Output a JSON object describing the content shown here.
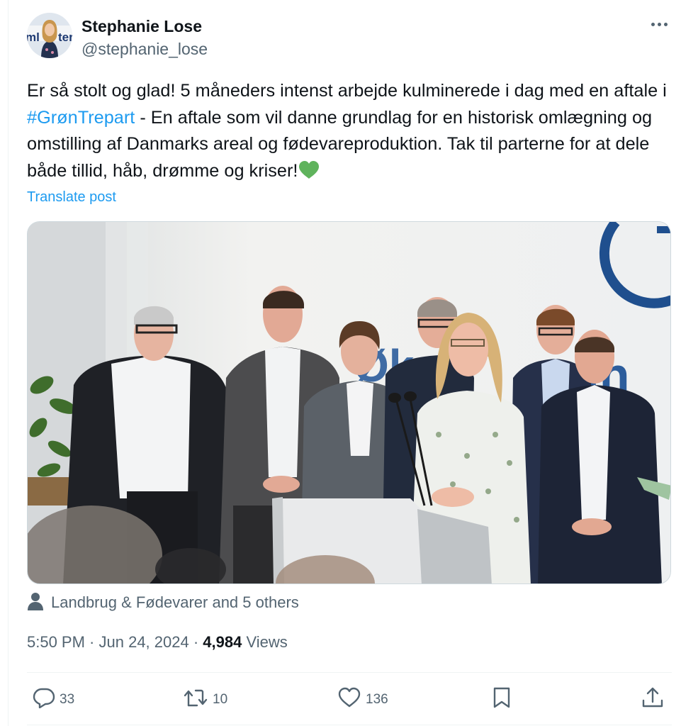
{
  "author": {
    "name": "Stephanie Lose",
    "handle": "@stephanie_lose",
    "avatar_icon": "profile-photo"
  },
  "tweet": {
    "text_before": "Er så stolt og glad! 5 måneders intenst arbejde kulminerede i dag med en aftale i ",
    "hashtag": "#GrønTrepart",
    "text_after": " - En aftale som vil danne grundlag for en historisk omlægning og omstilling af Danmarks areal og fødevareproduktion. Tak til parterne for at dele både tillid, håb, drømme og kriser!",
    "emoji": "green-heart-icon",
    "translate_label": "Translate post"
  },
  "media": {
    "type": "photo",
    "icon": "group-photo-press-conference"
  },
  "tagged": {
    "icon": "person-icon",
    "text": "Landbrug & Fødevarer and 5 others"
  },
  "meta": {
    "time": "5:50 PM",
    "sep1": " · ",
    "date": "Jun 24, 2024",
    "sep2": " · ",
    "views": "4,984",
    "views_label": " Views"
  },
  "actions": {
    "replies": "33",
    "reposts": "10",
    "likes": "136"
  },
  "colors": {
    "accent": "#1d9bf0",
    "text": "#0f1419",
    "secondary": "#536471",
    "heart_emoji": "#5fb35c"
  }
}
